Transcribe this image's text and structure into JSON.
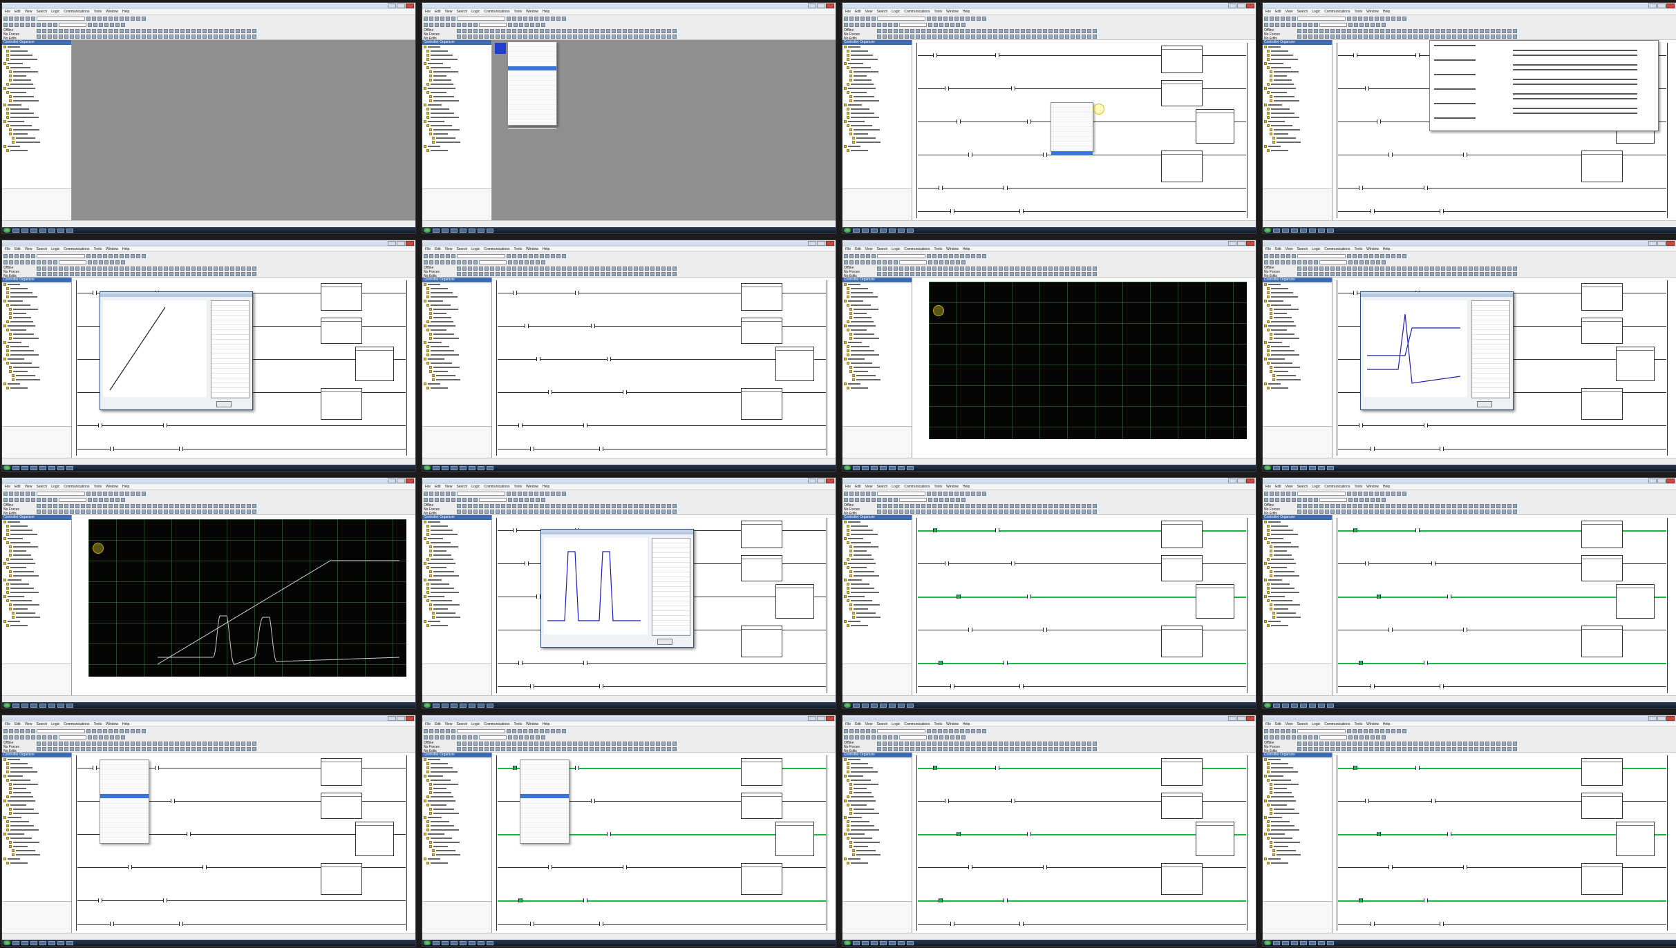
{
  "screen": {
    "thumbnail_count": 16
  },
  "app": {
    "menu": [
      "File",
      "Edit",
      "View",
      "Search",
      "Logic",
      "Communications",
      "Tools",
      "Window",
      "Help"
    ],
    "organizer_title": "Controller Organizer",
    "status": [
      "Offline",
      "No Forces",
      "No Edits"
    ]
  },
  "colors": {
    "energized": "#23b04a",
    "scope_bg": "#050505",
    "titlebar": "#c8d6e8",
    "highlight": "#3875d7"
  }
}
